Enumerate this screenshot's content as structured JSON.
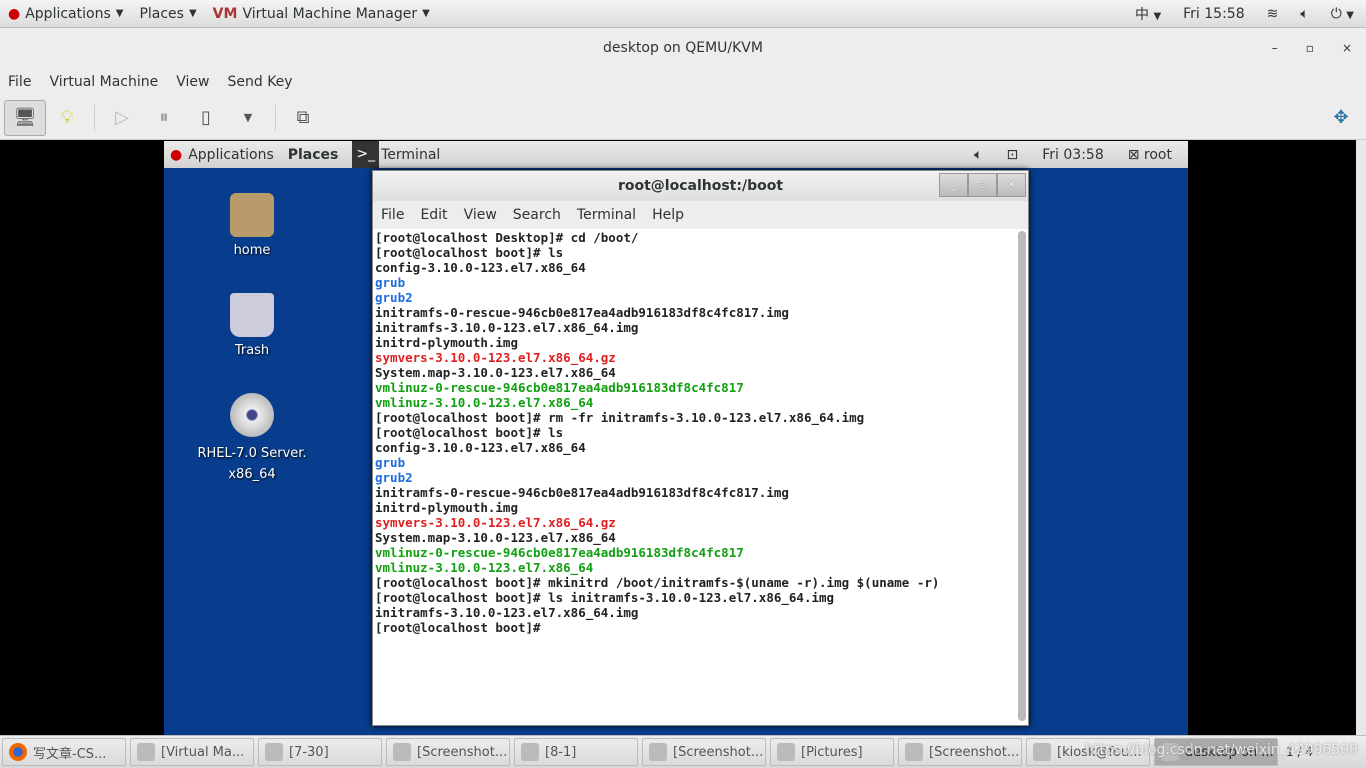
{
  "topbar": {
    "applications": "Applications",
    "places": "Places",
    "app": "Virtual Machine Manager",
    "input": "中",
    "clock": "Fri 15:58"
  },
  "window": {
    "title": "desktop on QEMU/KVM",
    "minimize": "–",
    "maximize": "▫",
    "close": "×"
  },
  "menu": [
    "File",
    "Virtual Machine",
    "View",
    "Send Key"
  ],
  "toolbar": {
    "icons": [
      "monitor-icon",
      "lightbulb-icon",
      "play-icon",
      "pause-icon",
      "power-icon",
      "dropdown-icon",
      "screens-icon"
    ]
  },
  "guest": {
    "topbar": {
      "applications": "Applications",
      "places": "Places",
      "terminal": "Terminal",
      "clock": "Fri 03:58",
      "user": "root"
    },
    "desktop_icons": [
      {
        "label": "home"
      },
      {
        "label": "Trash"
      },
      {
        "label": "RHEL-7.0 Server.\nx86_64"
      }
    ],
    "terminal": {
      "title": "root@localhost:/boot",
      "menu": [
        "File",
        "Edit",
        "View",
        "Search",
        "Terminal",
        "Help"
      ],
      "lines": [
        {
          "t": "[root@localhost Desktop]# cd /boot/",
          "c": ""
        },
        {
          "t": "[root@localhost boot]# ls",
          "c": ""
        },
        {
          "t": "config-3.10.0-123.el7.x86_64",
          "c": ""
        },
        {
          "t": "grub",
          "c": "blue"
        },
        {
          "t": "grub2",
          "c": "blue"
        },
        {
          "t": "initramfs-0-rescue-946cb0e817ea4adb916183df8c4fc817.img",
          "c": ""
        },
        {
          "t": "initramfs-3.10.0-123.el7.x86_64.img",
          "c": ""
        },
        {
          "t": "initrd-plymouth.img",
          "c": ""
        },
        {
          "t": "symvers-3.10.0-123.el7.x86_64.gz",
          "c": "red"
        },
        {
          "t": "System.map-3.10.0-123.el7.x86_64",
          "c": ""
        },
        {
          "t": "vmlinuz-0-rescue-946cb0e817ea4adb916183df8c4fc817",
          "c": "green"
        },
        {
          "t": "vmlinuz-3.10.0-123.el7.x86_64",
          "c": "green"
        },
        {
          "t": "[root@localhost boot]# rm -fr initramfs-3.10.0-123.el7.x86_64.img",
          "c": ""
        },
        {
          "t": "[root@localhost boot]# ls",
          "c": ""
        },
        {
          "t": "config-3.10.0-123.el7.x86_64",
          "c": ""
        },
        {
          "t": "grub",
          "c": "blue"
        },
        {
          "t": "grub2",
          "c": "blue"
        },
        {
          "t": "initramfs-0-rescue-946cb0e817ea4adb916183df8c4fc817.img",
          "c": ""
        },
        {
          "t": "initrd-plymouth.img",
          "c": ""
        },
        {
          "t": "symvers-3.10.0-123.el7.x86_64.gz",
          "c": "red"
        },
        {
          "t": "System.map-3.10.0-123.el7.x86_64",
          "c": ""
        },
        {
          "t": "vmlinuz-0-rescue-946cb0e817ea4adb916183df8c4fc817",
          "c": "green"
        },
        {
          "t": "vmlinuz-3.10.0-123.el7.x86_64",
          "c": "green"
        },
        {
          "t": "[root@localhost boot]# mkinitrd /boot/initramfs-$(uname -r).img $(uname -r)",
          "c": ""
        },
        {
          "t": "[root@localhost boot]# ls initramfs-3.10.0-123.el7.x86_64.img",
          "c": ""
        },
        {
          "t": "initramfs-3.10.0-123.el7.x86_64.img",
          "c": ""
        },
        {
          "t": "[root@localhost boot]# ",
          "c": ""
        }
      ]
    }
  },
  "taskbar": {
    "tasks": [
      {
        "label": "写文章-CS...",
        "active": false
      },
      {
        "label": "[Virtual Ma...",
        "active": false
      },
      {
        "label": "[7-30]",
        "active": false
      },
      {
        "label": "[Screenshot...",
        "active": false
      },
      {
        "label": "[8-1]",
        "active": false
      },
      {
        "label": "[Screenshot...",
        "active": false
      },
      {
        "label": "[Pictures]",
        "active": false
      },
      {
        "label": "[Screenshot...",
        "active": false
      },
      {
        "label": "[kiosk@fou...",
        "active": false
      },
      {
        "label": "desktop on ...",
        "active": true
      }
    ],
    "pager": "1 / 4",
    "watermark": "https://blog.csdn.net/weixin_42996500"
  },
  "colors": {
    "guest_desktop": "#073d8c",
    "dir": "#1c6be0",
    "archive": "#e02020",
    "exec": "#10a010"
  }
}
